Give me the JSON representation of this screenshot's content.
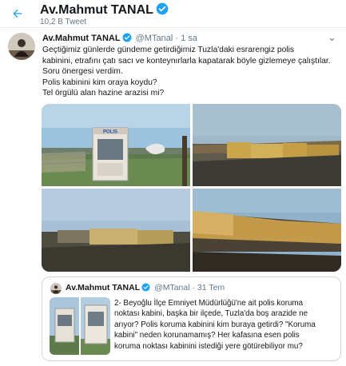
{
  "header": {
    "title": "Av.Mahmut TANAL",
    "tweet_count": "10,2 B Tweet"
  },
  "tweet": {
    "author_name": "Av.Mahmut TANAL",
    "handle": "@MTanal",
    "separator": "·",
    "time": "1 sa",
    "more": "⌄",
    "lines": [
      "Geçtiğimiz günlerde gündeme getirdiğimiz Tuzla'daki esrarengiz polis",
      "kabinini, etrafını çatı sacı ve konteynırlarla kapatarak böyle gizlemeye çalıştılar.",
      "Soru önergesi verdim.",
      "Polis kabinini kim oraya koydu?",
      "Tel örgülü alan hazine arazisi mi?"
    ],
    "photo_sign": "POLIS"
  },
  "quote": {
    "author_name": "Av.Mahmut TANAL",
    "handle": "@MTanal",
    "separator": "·",
    "date": "31 Tem",
    "lines": [
      "2- Beyoğlu İlçe Emniyet Müdürlüğü'ne ait polis koruma",
      "noktası kabini, başka bir ilçede, Tuzla'da boş arazide ne",
      "arıyor? Polis koruma kabinini kim buraya getirdi? \"Koruma",
      "kabini\" neden korunamamış? Her kafasına esen polis",
      "koruma noktası kabinini istediği yere götürebiliyor mu?"
    ]
  },
  "colors": {
    "accent": "#1da1f2",
    "text": "#14171a",
    "secondary": "#657786",
    "border": "#ccd6dd"
  },
  "icons": {
    "back": "back-arrow-icon",
    "verified": "verified-badge-icon",
    "more": "chevron-down-icon"
  }
}
